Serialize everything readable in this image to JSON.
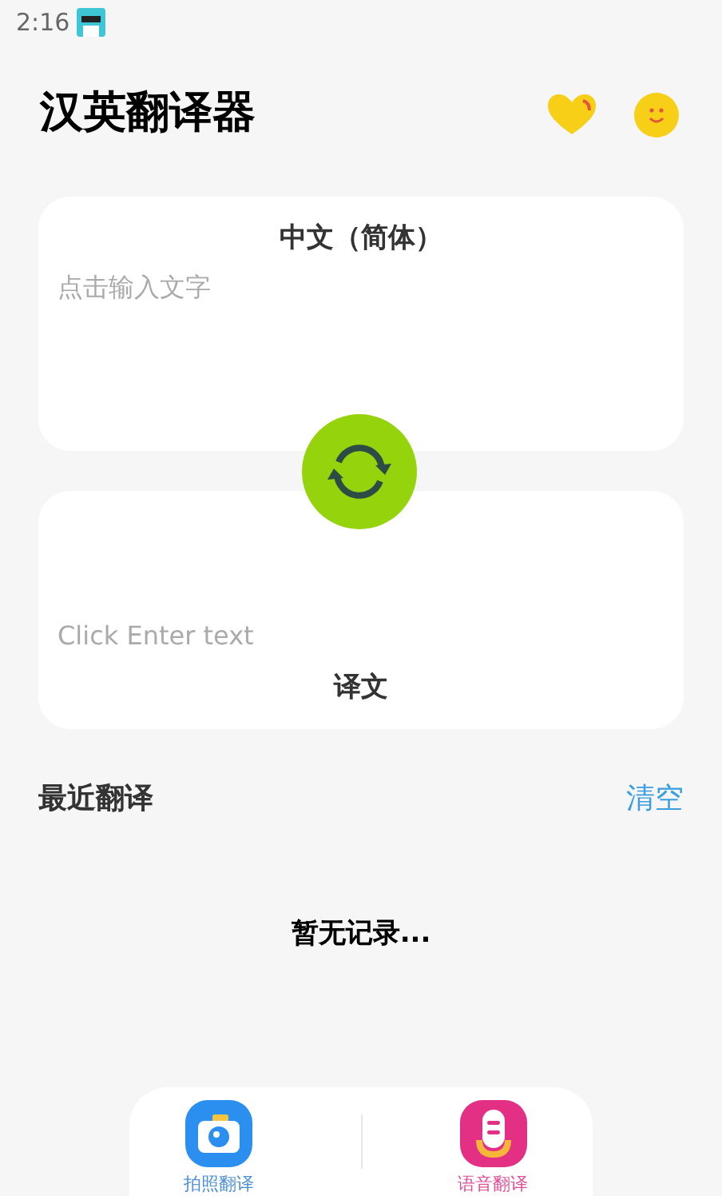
{
  "status_bar": {
    "time": "2:16"
  },
  "header": {
    "title": "汉英翻译器"
  },
  "source_card": {
    "language": "中文（简体）",
    "placeholder": "点击输入文字"
  },
  "target_card": {
    "placeholder": "Click Enter text",
    "language": "译文"
  },
  "recent": {
    "title": "最近翻译",
    "clear": "清空",
    "empty_text": "暂无记录..."
  },
  "bottom_actions": [
    {
      "kind": "camera",
      "label": "拍照翻译",
      "color": "#4a8fd8"
    },
    {
      "kind": "voice",
      "label": "语音翻译",
      "color": "#e0509a"
    }
  ]
}
